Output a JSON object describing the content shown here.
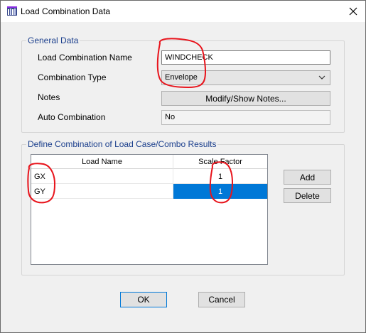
{
  "window": {
    "title": "Load Combination Data"
  },
  "general": {
    "legend": "General Data",
    "name_label": "Load Combination Name",
    "name_value": "WINDCHECK",
    "type_label": "Combination Type",
    "type_value": "Envelope",
    "notes_label": "Notes",
    "notes_button": "Modify/Show Notes...",
    "auto_label": "Auto Combination",
    "auto_value": "No"
  },
  "define": {
    "legend": "Define Combination of Load Case/Combo Results",
    "columns": [
      "Load Name",
      "Scale Factor"
    ],
    "rows": [
      {
        "name": "GX",
        "factor": "1"
      },
      {
        "name": "GY",
        "factor": "1"
      }
    ],
    "add_label": "Add",
    "delete_label": "Delete"
  },
  "footer": {
    "ok_label": "OK",
    "cancel_label": "Cancel"
  },
  "colors": {
    "accent": "#0078d7",
    "legend_text": "#1a3e8c",
    "annotation": "#e8141c"
  }
}
